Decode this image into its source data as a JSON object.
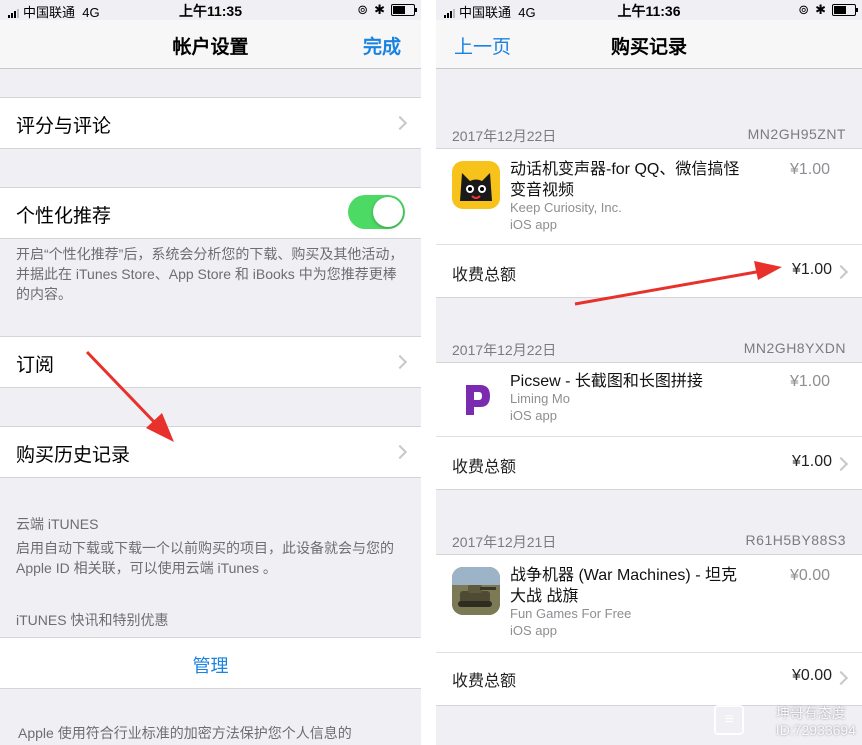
{
  "left": {
    "status": {
      "carrier": "中国联通",
      "network": "4G",
      "time": "上午11:35"
    },
    "nav": {
      "title": "帐户设置",
      "done": "完成"
    },
    "rows": {
      "ratings": "评分与评论",
      "personalized": "个性化推荐",
      "personalized_note": "开启“个性化推荐”后，系统会分析您的下载、购买及其他活动，并据此在 iTunes Store、App Store 和 iBooks 中为您推荐更棒的内容。",
      "personalized_on": true,
      "subscriptions": "订阅",
      "purchase_history": "购买历史记录"
    },
    "cloud": {
      "header": "云端 iTUNES",
      "note": "启用自动下载或下载一个以前购买的项目，此设备就会与您的 Apple ID 相关联，可以使用云端 iTunes 。"
    },
    "newsletter": {
      "header": "iTUNES 快讯和特别优惠",
      "manage": "管理"
    },
    "footer": "Apple 使用符合行业标准的加密方法保护您个人信息的"
  },
  "right": {
    "status": {
      "carrier": "中国联通",
      "network": "4G",
      "time": "上午11:36"
    },
    "nav": {
      "back": "上一页",
      "title": "购买记录"
    },
    "total_label": "收费总额",
    "purchases": [
      {
        "date": "2017年12月22日",
        "order_id": "MN2GH95ZNT",
        "app_name": "动话机变声器-for QQ、微信搞怪变音视频",
        "developer": "Keep Curiosity, Inc.",
        "platform": "iOS app",
        "price": "¥1.00",
        "total": "¥1.00"
      },
      {
        "date": "2017年12月22日",
        "order_id": "MN2GH8YXDN",
        "app_name": "Picsew - 长截图和长图拼接",
        "developer": "Liming Mo",
        "platform": "iOS app",
        "price": "¥1.00",
        "total": "¥1.00"
      },
      {
        "date": "2017年12月21日",
        "order_id": "R61H5BY88S3",
        "app_name": "战争机器 (War Machines) - 坦克大战 战旗",
        "developer": "Fun Games For Free",
        "platform": "iOS app",
        "price": "¥0.00",
        "total": "¥0.00"
      }
    ]
  },
  "watermark": {
    "line1": "坤哥有态度",
    "line2": "ID:72933694"
  },
  "colors": {
    "accent": "#1a82e0",
    "toggle_on": "#4cd964",
    "arrow": "#e8312a"
  }
}
